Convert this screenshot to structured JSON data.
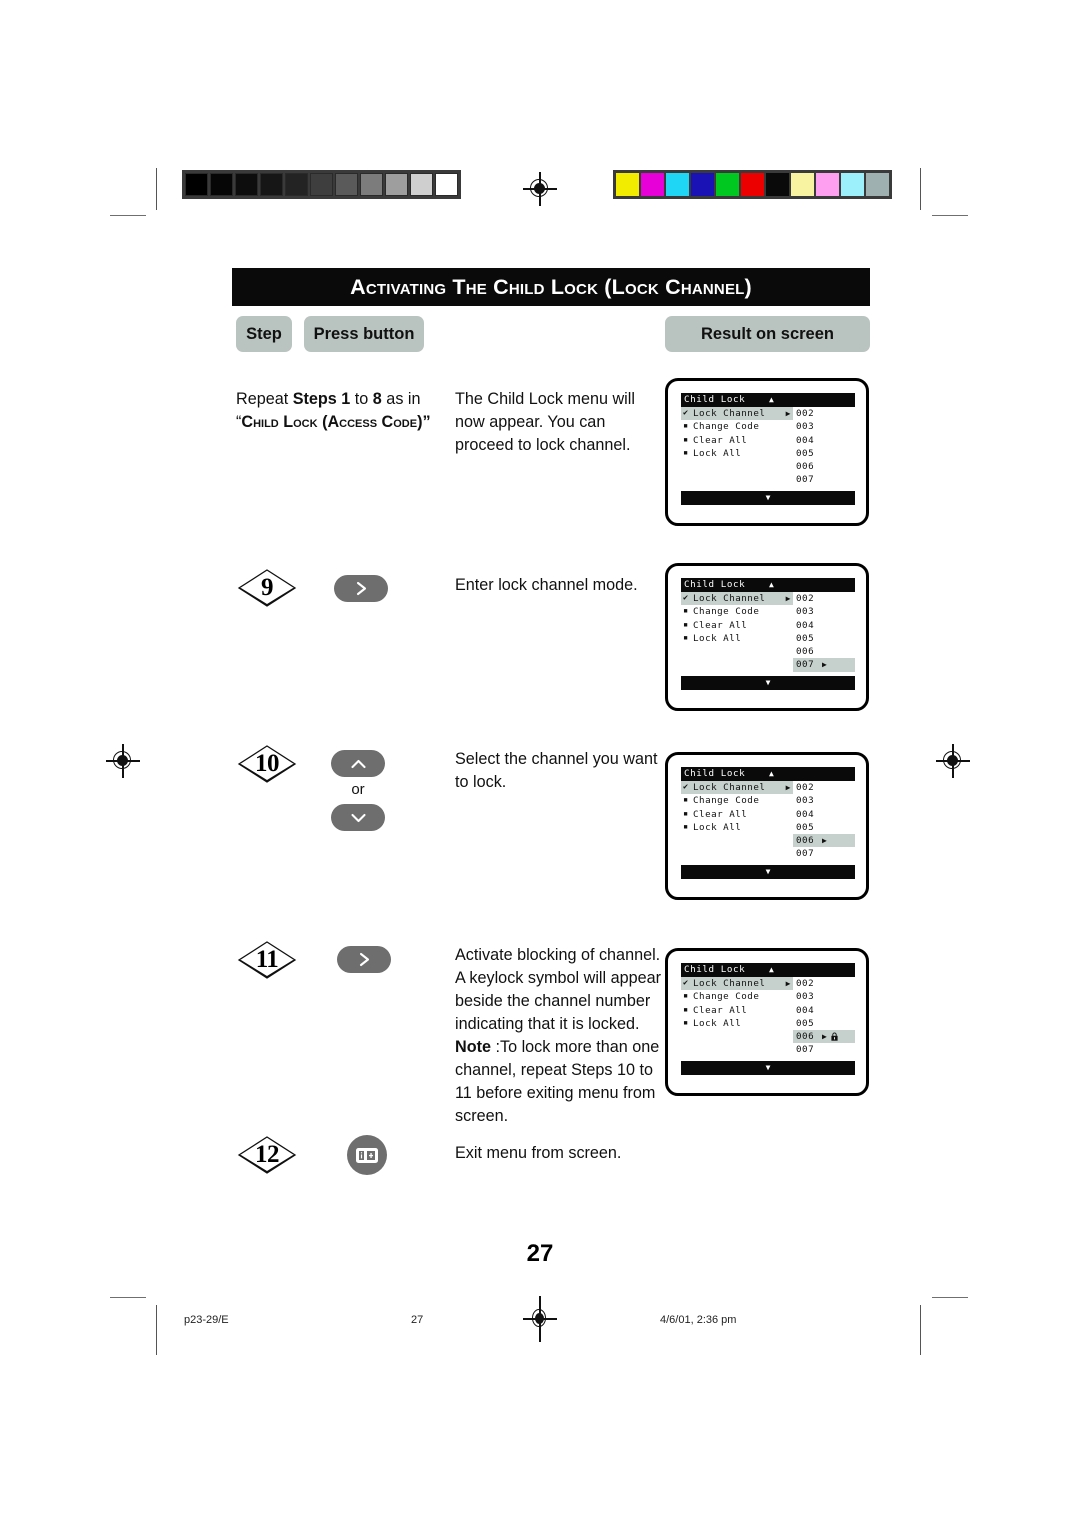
{
  "document": {
    "page_number": "27",
    "title": "Activating the Child Lock (Lock Channel)"
  },
  "table_headers": {
    "step": "Step",
    "press_button": "Press button",
    "result": "Result on screen"
  },
  "rows": [
    {
      "step_label": "",
      "button_icon": "",
      "press_text_line1": "Repeat ",
      "press_bold1": "Steps 1",
      "press_mid": " to ",
      "press_bold2": "8",
      "press_tail": " as",
      "press_line2_prefix": "in “",
      "press_line2_smallcaps": "Child Lock (Access Code)”",
      "description": "The Child Lock menu will now appear. You can proceed to lock channel.",
      "screen": {
        "title": "Child Lock",
        "up_arrow": "▲",
        "down_arrow": "▼",
        "menu": [
          {
            "mark": "✔",
            "label": "Lock Channel",
            "arrow": "▶",
            "selected": true
          },
          {
            "mark": "▪",
            "label": "Change Code",
            "arrow": "",
            "selected": false
          },
          {
            "mark": "▪",
            "label": "Clear All",
            "arrow": "",
            "selected": false
          },
          {
            "mark": "▪",
            "label": "Lock All",
            "arrow": "",
            "selected": false
          }
        ],
        "channels": [
          {
            "num": "002",
            "arrow": "",
            "selected": false,
            "locked": false
          },
          {
            "num": "003",
            "arrow": "",
            "selected": false,
            "locked": false
          },
          {
            "num": "004",
            "arrow": "",
            "selected": false,
            "locked": false
          },
          {
            "num": "005",
            "arrow": "",
            "selected": false,
            "locked": false
          },
          {
            "num": "006",
            "arrow": "",
            "selected": false,
            "locked": false
          },
          {
            "num": "007",
            "arrow": "",
            "selected": false,
            "locked": false
          }
        ]
      }
    },
    {
      "step_label": "9",
      "button_icon": "chevron-right",
      "description": "Enter lock channel mode.",
      "screen": {
        "title": "Child Lock",
        "up_arrow": "▲",
        "down_arrow": "▼",
        "menu": [
          {
            "mark": "✔",
            "label": "Lock Channel",
            "arrow": "▶",
            "selected": true
          },
          {
            "mark": "▪",
            "label": "Change Code",
            "arrow": "",
            "selected": false
          },
          {
            "mark": "▪",
            "label": "Clear All",
            "arrow": "",
            "selected": false
          },
          {
            "mark": "▪",
            "label": "Lock All",
            "arrow": "",
            "selected": false
          }
        ],
        "channels": [
          {
            "num": "002",
            "arrow": "",
            "selected": false,
            "locked": false
          },
          {
            "num": "003",
            "arrow": "",
            "selected": false,
            "locked": false
          },
          {
            "num": "004",
            "arrow": "",
            "selected": false,
            "locked": false
          },
          {
            "num": "005",
            "arrow": "",
            "selected": false,
            "locked": false
          },
          {
            "num": "006",
            "arrow": "",
            "selected": false,
            "locked": false
          },
          {
            "num": "007",
            "arrow": "▶",
            "selected": true,
            "locked": false
          }
        ]
      }
    },
    {
      "step_label": "10",
      "button_icon": "chevron-up-down",
      "or_label": "or",
      "description": "Select the channel you want to lock.",
      "screen": {
        "title": "Child Lock",
        "up_arrow": "▲",
        "down_arrow": "▼",
        "menu": [
          {
            "mark": "✔",
            "label": "Lock Channel",
            "arrow": "▶",
            "selected": true
          },
          {
            "mark": "▪",
            "label": "Change Code",
            "arrow": "",
            "selected": false
          },
          {
            "mark": "▪",
            "label": "Clear All",
            "arrow": "",
            "selected": false
          },
          {
            "mark": "▪",
            "label": "Lock All",
            "arrow": "",
            "selected": false
          }
        ],
        "channels": [
          {
            "num": "002",
            "arrow": "",
            "selected": false,
            "locked": false
          },
          {
            "num": "003",
            "arrow": "",
            "selected": false,
            "locked": false
          },
          {
            "num": "004",
            "arrow": "",
            "selected": false,
            "locked": false
          },
          {
            "num": "005",
            "arrow": "",
            "selected": false,
            "locked": false
          },
          {
            "num": "006",
            "arrow": "▶",
            "selected": true,
            "locked": false
          },
          {
            "num": "007",
            "arrow": "",
            "selected": false,
            "locked": false
          }
        ]
      }
    },
    {
      "step_label": "11",
      "button_icon": "chevron-right",
      "description": "Activate blocking of channel. A keylock symbol will appear beside the channel number indicating that it is locked.",
      "note_label": "Note",
      "note_text": " :To lock more than one channel, repeat Steps 10 to 11 before exiting menu from screen.",
      "screen": {
        "title": "Child Lock",
        "up_arrow": "▲",
        "down_arrow": "▼",
        "menu": [
          {
            "mark": "✔",
            "label": "Lock Channel",
            "arrow": "▶",
            "selected": true
          },
          {
            "mark": "▪",
            "label": "Change Code",
            "arrow": "",
            "selected": false
          },
          {
            "mark": "▪",
            "label": "Clear All",
            "arrow": "",
            "selected": false
          },
          {
            "mark": "▪",
            "label": "Lock All",
            "arrow": "",
            "selected": false
          }
        ],
        "channels": [
          {
            "num": "002",
            "arrow": "",
            "selected": false,
            "locked": false
          },
          {
            "num": "003",
            "arrow": "",
            "selected": false,
            "locked": false
          },
          {
            "num": "004",
            "arrow": "",
            "selected": false,
            "locked": false
          },
          {
            "num": "005",
            "arrow": "",
            "selected": false,
            "locked": false
          },
          {
            "num": "006",
            "arrow": "▶",
            "selected": true,
            "locked": true
          },
          {
            "num": "007",
            "arrow": "",
            "selected": false,
            "locked": false
          }
        ]
      }
    },
    {
      "step_label": "12",
      "button_icon": "menu-exit",
      "description": "Exit menu from screen.",
      "screen": null
    }
  ],
  "footer": {
    "file_ref": "p23-29/E",
    "page": "27",
    "timestamp": "4/6/01, 2:36 pm"
  },
  "calibration": {
    "gray_swatches": [
      "#000000",
      "#060606",
      "#0d0d0d",
      "#161616",
      "#232323",
      "#3e3e3e",
      "#5a5a5a",
      "#7c7c7c",
      "#9e9e9e",
      "#cfcfcf",
      "#ffffff"
    ],
    "color_swatches": [
      "#f2ec00",
      "#e800d8",
      "#20d6f5",
      "#1a12b5",
      "#00c820",
      "#ed0000",
      "#0a0a0a",
      "#f7f3a0",
      "#ff9ff0",
      "#9bf0fb",
      "#9fb0b0"
    ]
  }
}
